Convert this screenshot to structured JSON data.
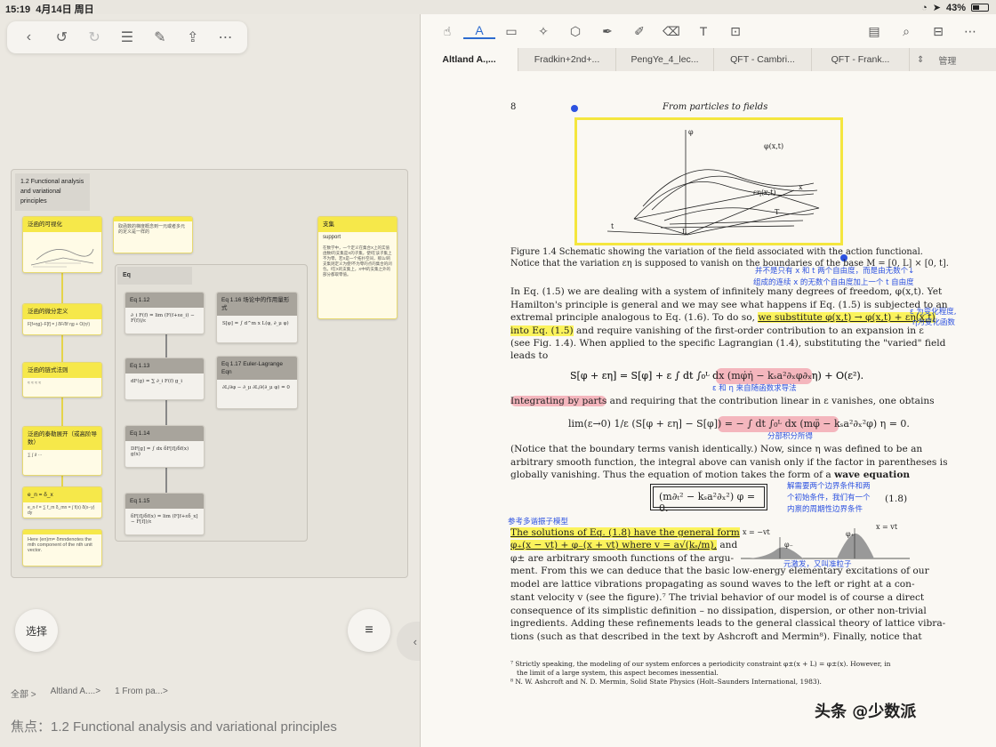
{
  "status": {
    "time": "15:19",
    "date": "4月14日 周日",
    "battery": "43%"
  },
  "left_toolbar": {
    "icons": [
      "back-icon",
      "undo-icon",
      "redo-icon",
      "list-icon",
      "edit-icon",
      "share-icon",
      "more-icon"
    ]
  },
  "mindmap": {
    "root": "1.2 Functional analysis and variational principles",
    "cards": {
      "c1": "泛函的可视化",
      "c2": "泛函的微分定义",
      "c2b": "F[f+ηg]−F[f] = ∫ δF/δf ηg + O(η²)",
      "c3": "泛函的链式法则",
      "c4": "泛函的泰勒展开（或高阶导数）",
      "c5": "e_n = δ_x",
      "c5b": "e_n·f = ∑ f_m δ_mn = ∫ f(x) δ(x−y) dy",
      "c6": "Here (en)m= δmndenotes the mth component of the nth unit vector.",
      "c_small": "取函数的梯度概念到一元或者多元的定义是一样的",
      "support_head": "支集",
      "support_title": "support",
      "support_body": "在数学中，一个定义在集合X上的实值函数f的支集是X的子集，使f在该子集上不为零。若X是一个拓扑空间，那么f的支集则定义为使f不为零的点的集合的闭包。f在X的支集上，X中f的支集之外的部分都取零值。",
      "eq_group": "Eq",
      "eq12": "Eq 1.12",
      "eq12b": "∂_i F(f) = lim (F(f+εe_i) − F(f))/ε",
      "eq13": "Eq 1.13",
      "eq13b": "dF(g) = ∑ ∂_i F(f) g_i",
      "eq14": "Eq 1.14",
      "eq14b": "DF[g] = ∫ dx δF[f]/δf(x) g(x)",
      "eq15": "Eq 1.15",
      "eq15b": "δF[f]/δf(x) = lim (F[f+εδ_x] − F[f])/ε",
      "eq16": "Eq 1.16 场论中的作用量形式",
      "eq16b": "S[φ] = ∫ d^m x L(φ, ∂_μ φ)",
      "eq17": "Eq 1.17 Euler-Lagrange Eqn",
      "eq17b": "∂L/∂φ − ∂_μ ∂L/∂(∂_μ φ) = 0"
    }
  },
  "buttons": {
    "select": "选择"
  },
  "breadcrumb": [
    "全部",
    "Altland A....",
    "1 From pa..."
  ],
  "focus": "焦点：1.2 Functional analysis and variational principles",
  "tabs": [
    "Altland A.,...",
    "Fradkin+2nd+...",
    "PengYe_4_lec...",
    "QFT - Cambri...",
    "QFT - Frank..."
  ],
  "tab_manage": "管理",
  "doc": {
    "page_no": "8",
    "running_head": "From particles to fields",
    "fig_labels": {
      "phi": "φ",
      "phixt": "φ(x,t)",
      "eta": "εη(x,t)",
      "x": "x",
      "T": "T",
      "t": "t",
      "L": "L"
    },
    "lines": [
      "Figure 1.4 Schematic showing the variation of the field associated with the action functional.",
      "Notice that the variation εη is supposed to vanish on the boundaries of the base M = [0, L] × [0, t].",
      "In Eq. (1.5) we are dealing with a system of infinitely many degrees of freedom, φ(x,t). Yet",
      "Hamilton's principle is general and we may see what happens if Eq. (1.5) is subjected to an",
      "extremal principle analogous to Eq. (1.6). To do so, ",
      "we substitute φ(x,t) → φ(x,t) + εη(x,t)",
      "into Eq. (1.5)",
      " and require vanishing of the first-order contribution to an expansion in ε",
      "(see Fig. 1.4). When applied to the specific Lagrangian (1.4), substituting the \"varied\" field",
      "leads to",
      "S[φ + εη] = S[φ] + ε ∫ dt ∫₀ᴸ dx (mφ̇η̇ − kₛa²∂ₓφ∂ₓη) + O(ε²).",
      "Integrating by parts",
      " and requiring that the contribution linear in ε vanishes, one obtains",
      "lim(ε→0) 1/ε (S[φ + εη] − S[φ]) = − ∫ dt ∫₀ᴸ dx (mφ̈ − kₛa²∂ₓ²φ) η = 0.",
      "(Notice that the boundary terms vanish identically.) Now, since η was defined to be an",
      "arbitrary smooth function, the integral above can vanish only if the factor in parentheses is",
      "globally vanishing. Thus the equation of motion takes the form of a ",
      "wave equation",
      "(m∂ₜ² − kₛa²∂ₓ²) φ = 0.",
      "(1.8)",
      "The solutions of Eq. (1.8) have the general form",
      "φ₊(x − vt) + φ₋(x + vt) where v = a√(kₛ/m),",
      " and",
      "φ± are arbitrary smooth functions of the argu-",
      "ment. From this we can deduce that the basic low-energy elementary excitations of our",
      "model are lattice vibrations propagating as sound waves to the left or right at a con-",
      "stant velocity v (see the figure).⁷ The trivial behavior of our model is of course a direct",
      "consequence of its simplistic definition – no dissipation, dispersion, or other non-trivial",
      "ingredients. Adding these refinements leads to the general classical theory of lattice vibra-",
      "tions (such as that described in the text by Ashcroft and Mermin⁸). Finally, notice that"
    ],
    "wave_labels": {
      "left": "x = −vt",
      "phim": "φ₋",
      "phip": "φ₊",
      "right": "x = vt"
    },
    "footnotes": [
      "⁷ Strictly speaking, the modeling of our system enforces a periodicity constraint φ±(x + L) = φ±(x). However, in",
      "the limit of a large system, this aspect becomes inessential.",
      "⁸ N. W. Ashcroft and N. D. Mermin, Solid State Physics (Holt–Saunders International, 1983)."
    ],
    "annotations": {
      "a1": "并不是只有 x 和 t 两个自由度，而是由无数个↓",
      "a2": "组成的连续 x 的无数个自由度加上一个 t 自由度",
      "a3": "ε 为变化程度,",
      "a4": "η为变化函数",
      "a5": "ε 和 η 来自随函数求导法",
      "a6": "分部积分所得",
      "a7": "解需要两个边界条件和两",
      "a8": "个初始条件，我们有一个",
      "a9": "内禀的周期性边界条件",
      "a10": "参考多谐振子模型",
      "a11": "元激发，又叫准粒子"
    }
  },
  "watermark": "头条 @少数派",
  "colors": {
    "highlight": "#fbf35c",
    "pink": "#f4b6bd",
    "ink_blue": "#2d52e0",
    "accent": "#2d6bcf"
  }
}
